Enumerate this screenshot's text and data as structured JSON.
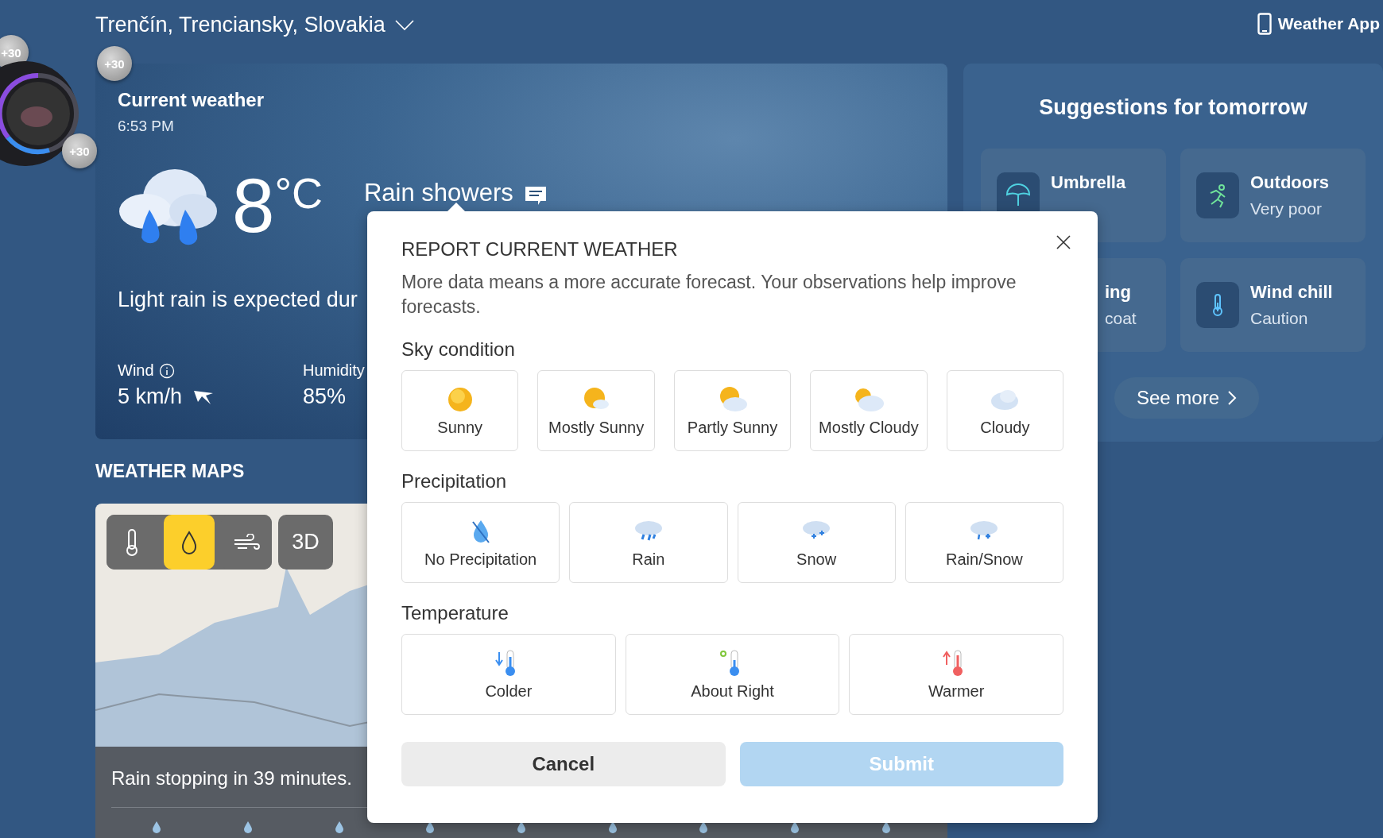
{
  "header": {
    "location": "Trenčín, Trenciansky, Slovakia",
    "app_link": "Weather App"
  },
  "badges": [
    "+30",
    "+30",
    "+30"
  ],
  "current": {
    "title": "Current weather",
    "time": "6:53 PM",
    "temperature": "8",
    "unit": "°C",
    "condition": "Rain showers",
    "summary": "Light rain is expected dur",
    "stats": [
      {
        "label": "Wind",
        "info": true,
        "value": "5 km/h",
        "arrow": true
      },
      {
        "label": "Humidity",
        "value": "85%",
        "arrow": false
      }
    ]
  },
  "maps": {
    "title": "WEATHER MAPS",
    "layers": [
      {
        "kind": "temperature",
        "selected": false
      },
      {
        "kind": "precipitation",
        "selected": true
      },
      {
        "kind": "wind",
        "selected": false
      }
    ],
    "mode": "3D",
    "status": "Rain stopping in 39 minutes."
  },
  "suggestions": {
    "title": "Suggestions for tomorrow",
    "items": [
      {
        "kind": "umbrella",
        "title": "Umbrella",
        "value": ""
      },
      {
        "kind": "outdoors",
        "title": "Outdoors",
        "value": "Very poor"
      },
      {
        "kind": "hidden",
        "title": "ing",
        "value": "coat"
      },
      {
        "kind": "windchill",
        "title": "Wind chill",
        "value": "Caution"
      }
    ],
    "more": "See more"
  },
  "dialog": {
    "title": "REPORT CURRENT WEATHER",
    "description": "More data means a more accurate forecast. Your observations help improve forecasts.",
    "sections": [
      {
        "title": "Sky condition",
        "options": [
          {
            "kind": "sunny",
            "label": "Sunny",
            "selected": false
          },
          {
            "kind": "mostly-sunny",
            "label": "Mostly Sunny",
            "selected": false
          },
          {
            "kind": "partly-sunny",
            "label": "Partly Sunny",
            "selected": false
          },
          {
            "kind": "mostly-cloudy",
            "label": "Mostly Cloudy",
            "selected": false
          },
          {
            "kind": "cloudy",
            "label": "Cloudy",
            "selected": false
          }
        ]
      },
      {
        "title": "Precipitation",
        "options": [
          {
            "kind": "none",
            "label": "No Precipitation",
            "selected": false
          },
          {
            "kind": "rain",
            "label": "Rain",
            "selected": false
          },
          {
            "kind": "snow",
            "label": "Snow",
            "selected": false
          },
          {
            "kind": "rain-snow",
            "label": "Rain/Snow",
            "selected": false
          }
        ]
      },
      {
        "title": "Temperature",
        "options": [
          {
            "kind": "colder",
            "label": "Colder",
            "selected": false
          },
          {
            "kind": "right",
            "label": "About Right",
            "selected": false
          },
          {
            "kind": "warmer",
            "label": "Warmer",
            "selected": false
          }
        ]
      }
    ],
    "cancel": "Cancel",
    "submit": {
      "label": "Submit",
      "disabled": true
    }
  }
}
